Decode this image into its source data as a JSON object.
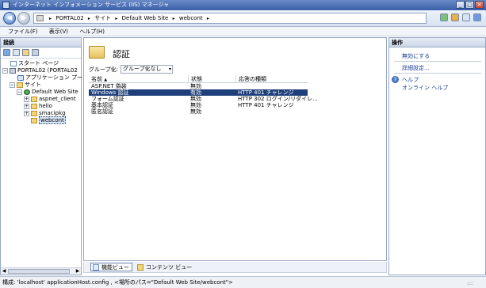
{
  "window": {
    "title": "インターネット インフォメーション サービス (IIS) マネージャ",
    "controls": {
      "minimize": "_",
      "maximize": "□",
      "close": "×"
    }
  },
  "address": {
    "crumbs": [
      "PORTAL02",
      "サイト",
      "Default Web Site",
      "webcont"
    ],
    "separator": "▸",
    "end": "▸"
  },
  "nav": {
    "back_icon": "back-arrow-icon",
    "forward_icon": "forward-arrow-icon",
    "back": "◀",
    "forward": "▶"
  },
  "menu": {
    "file": "ファイル(F)",
    "view": "表示(V)",
    "help": "ヘルプ(H)"
  },
  "connections": {
    "header": "接続",
    "tree": {
      "start_page": "スタート ページ",
      "server": "PORTAL02 (PORTAL02",
      "app_pools": "アプリケーション プール",
      "sites": "サイト",
      "default_site": "Default Web Site",
      "aspnet_client": "aspnet_client",
      "hello": "hello",
      "smacipkg": "smacipkg",
      "webcont": "webcont"
    },
    "expand_minus": "−",
    "expand_plus": "+",
    "scroll_left": "◀",
    "scroll_right": "▶"
  },
  "main": {
    "feature_title": "認証",
    "group_by_label": "グループ化:",
    "group_by_value": "グループ化なし",
    "dropdown_arrow": "▾",
    "columns": {
      "name": "名前",
      "sort_indicator": "▲",
      "status": "状態",
      "response_type": "応答の種類"
    },
    "rows": [
      {
        "name": "ASP.NET 偽装",
        "status": "無効",
        "response": ""
      },
      {
        "name": "Windows 認証",
        "status": "有効",
        "response": "HTTP 401 チャレンジ"
      },
      {
        "name": "フォーム認証",
        "status": "無効",
        "response": "HTTP 302 ログイン/リダイレ..."
      },
      {
        "name": "基本認証",
        "status": "無効",
        "response": "HTTP 401 チャレンジ"
      },
      {
        "name": "匿名認証",
        "status": "無効",
        "response": ""
      }
    ],
    "selected_row": 1
  },
  "view_tabs": {
    "features": "機能ビュー",
    "content": "コンテンツ ビュー"
  },
  "actions": {
    "header": "操作",
    "disable": "無効にする",
    "advanced": "詳細設定...",
    "help": "ヘルプ",
    "online_help": "オンライン ヘルプ",
    "help_glyph": "?"
  },
  "status": {
    "text": "構成: 'localhost' applicationHost.config , <場所のパス=\"Default Web Site/webcont\">",
    "grip": "::::"
  },
  "colors": {
    "selection": "#1e3f7a",
    "link": "#1a3e92",
    "title_bar": "#3a5fa8"
  }
}
